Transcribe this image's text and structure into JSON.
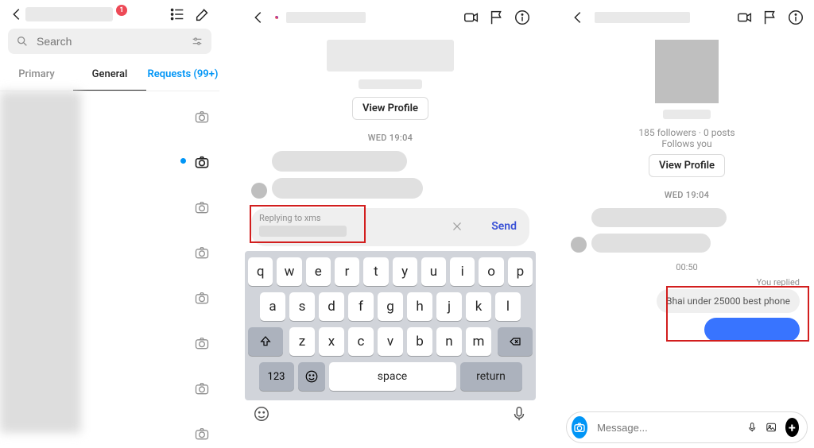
{
  "panel1": {
    "badge": "1",
    "search_placeholder": "Search",
    "tabs": {
      "primary": "Primary",
      "general": "General",
      "requests": "Requests (99+)"
    }
  },
  "panel2": {
    "view_profile": "View Profile",
    "timestamp": "WED 19:04",
    "reply_label": "Replying to xms",
    "send": "Send",
    "keys_r1": [
      "q",
      "w",
      "e",
      "r",
      "t",
      "y",
      "u",
      "i",
      "o",
      "p"
    ],
    "keys_r2": [
      "a",
      "s",
      "d",
      "f",
      "g",
      "h",
      "j",
      "k",
      "l"
    ],
    "keys_r3": [
      "z",
      "x",
      "c",
      "v",
      "b",
      "n",
      "m"
    ],
    "k123": "123",
    "kspace": "space",
    "kreturn": "return"
  },
  "panel3": {
    "stats": "185 followers · 0 posts",
    "follows": "Follows you",
    "view_profile": "View Profile",
    "timestamp": "WED 19:04",
    "time2": "00:50",
    "you_replied": "You replied",
    "quote": "Bhai under 25000 best phone",
    "composer_placeholder": "Message..."
  }
}
